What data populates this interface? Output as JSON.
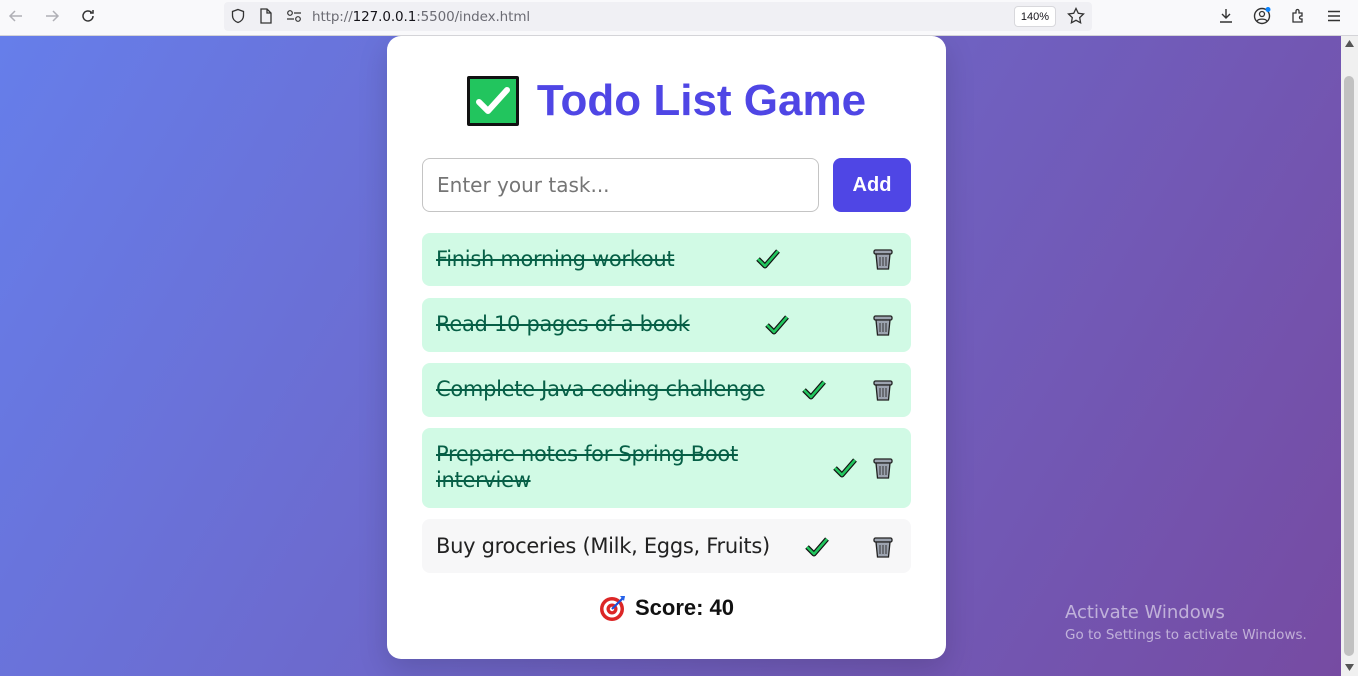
{
  "browser": {
    "url_prefix": "http://",
    "url_host": "127.0.0.1",
    "url_rest": ":5500/index.html",
    "zoom": "140%"
  },
  "app": {
    "title": "Todo List Game",
    "input_placeholder": "Enter your task...",
    "add_label": "Add",
    "score_label": "Score: 40"
  },
  "todos": [
    {
      "text": "Finish morning workout",
      "completed": true
    },
    {
      "text": "Read 10 pages of a book",
      "completed": true
    },
    {
      "text": "Complete Java coding challenge",
      "completed": true
    },
    {
      "text": "Prepare notes for Spring Boot interview",
      "completed": true
    },
    {
      "text": "Buy groceries (Milk, Eggs, Fruits)",
      "completed": false
    }
  ],
  "os_watermark": {
    "line1": "Activate Windows",
    "line2": "Go to Settings to activate Windows."
  },
  "colors": {
    "accent": "#4f46e5",
    "completed_bg": "#d1fae5",
    "completed_text": "#065f46",
    "gradient_start": "#667eea",
    "gradient_end": "#764ba2"
  }
}
